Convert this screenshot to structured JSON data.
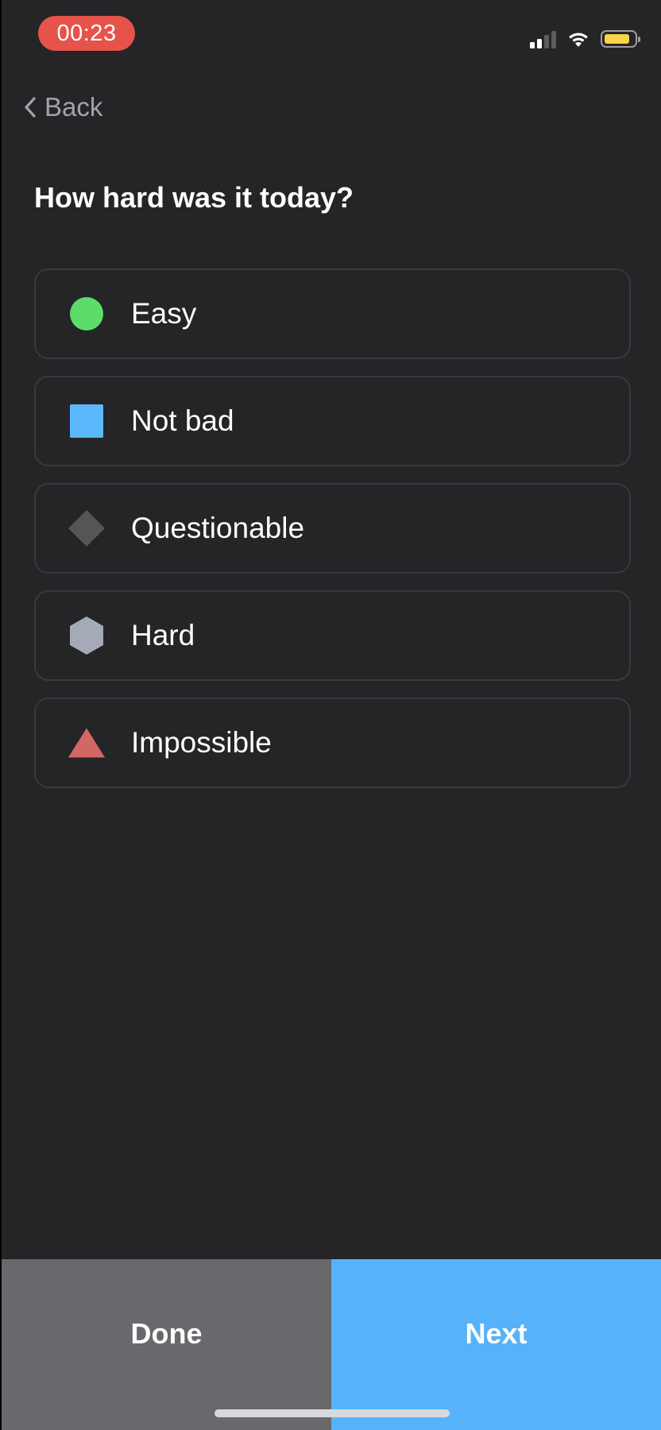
{
  "status_bar": {
    "time": "00:23",
    "recording_color": "#e5534b",
    "signal_icon": "cellular-signal-icon",
    "wifi_icon": "wifi-icon",
    "battery_icon": "battery-icon",
    "battery_level": 0.85,
    "battery_color": "#f5d547"
  },
  "nav": {
    "back_label": "Back",
    "back_icon": "chevron-left-icon"
  },
  "question": {
    "title": "How hard was it today?"
  },
  "options": [
    {
      "label": "Easy",
      "icon": "green-circle-icon",
      "color": "#5cdd6b"
    },
    {
      "label": "Not bad",
      "icon": "blue-square-icon",
      "color": "#5ab8fb"
    },
    {
      "label": "Questionable",
      "icon": "gray-diamond-icon",
      "color": "#555457"
    },
    {
      "label": "Hard",
      "icon": "gray-hexagon-icon",
      "color": "#a4abb6"
    },
    {
      "label": "Impossible",
      "icon": "red-triangle-icon",
      "color": "#d36766"
    }
  ],
  "actions": {
    "done_label": "Done",
    "done_color": "#69686c",
    "next_label": "Next",
    "next_color": "#56b2f9"
  }
}
